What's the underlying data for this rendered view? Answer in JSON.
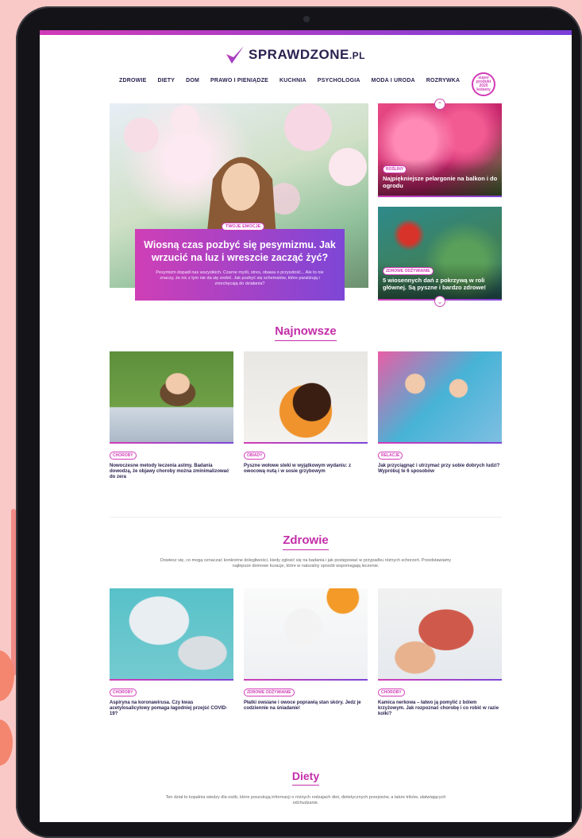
{
  "site": {
    "logo_main": "SPRAWDZONE",
    "logo_suffix": ".PL",
    "award_badge": "super produkt 2020 kobiety"
  },
  "nav": {
    "items": [
      "ZDROWIE",
      "DIETY",
      "DOM",
      "PRAWO I PIENIĄDZE",
      "KUCHNIA",
      "PSYCHOLOGIA",
      "MODA I URODA",
      "ROZRYWKA"
    ]
  },
  "hero": {
    "tag": "TWOJE EMOCJE",
    "title": "Wiosną czas pozbyć się pesymizmu. Jak wrzucić na luz i wreszcie zacząć żyć?",
    "description": "Pesymizm dopadł nas wszystkich. Czarne myśli, stres, obawa o przyszłość... Ale to nie znaczy, że nic z tym nie da się zrobić. Jak pozbyć się schematów, które paraliżują i zniechęcają do działania?"
  },
  "side": [
    {
      "tag": "ROŚLINY",
      "title": "Najpiękniejsze pelargonie na balkon i do ogrodu"
    },
    {
      "tag": "ZDROWE ODŻYWIANIE",
      "title": "5 wiosennych dań z pokrzywą w roli głównej. Są pyszne i bardzo zdrowe!"
    }
  ],
  "najnowsze": {
    "title": "Najnowsze",
    "cards": [
      {
        "tag": "CHOROBY",
        "title": "Nowoczesne metody leczenia astmy. Badania dowodzą, że objawy choroby można zminimalizować do zera"
      },
      {
        "tag": "OBIADY",
        "title": "Pyszne wołowe steki w wyjątkowym wydaniu: z owocową nutą i w sosie grzybowym"
      },
      {
        "tag": "RELACJE",
        "title": "Jak przyciągnąć i utrzymać przy sobie dobrych ludzi? Wypróbuj te 6 sposobów"
      }
    ]
  },
  "zdrowie": {
    "title": "Zdrowie",
    "description": "Dowiesz się, co mogą oznaczać konkretne dolegliwości, kiedy zgłosić się na badania i jak postępować w przypadku różnych schorzeń. Przedstawiamy najlepsze domowe kuracje, które w naturalny sposób wspomagają leczenie.",
    "cards": [
      {
        "tag": "CHOROBY",
        "title": "Aspiryna na koronawirusa. Czy kwas acetylosalicylowy pomaga łagodniej przejść COVID-19?"
      },
      {
        "tag": "ZDROWE ODŻYWIANIE",
        "title": "Płatki owsiane i owoce poprawią stan skóry. Jedz je codziennie na śniadanie!"
      },
      {
        "tag": "CHOROBY",
        "title": "Kamica nerkowa – łatwo ją pomylić z bólem krzyżowym. Jak rozpoznać chorobę i co robić w razie kolki?"
      }
    ]
  },
  "diety": {
    "title": "Diety",
    "description": "Ten dział to kopalnia wiedzy dla osób, które poszukują informacji o różnych rodzajach diet, dietetycznych przepisów, a także trików, ułatwiających odchudzanie."
  },
  "colors": {
    "accent": "#c32ea8",
    "gradient_start": "#cf3fb6",
    "gradient_end": "#7e46d6",
    "nav_text": "#2b2150"
  }
}
